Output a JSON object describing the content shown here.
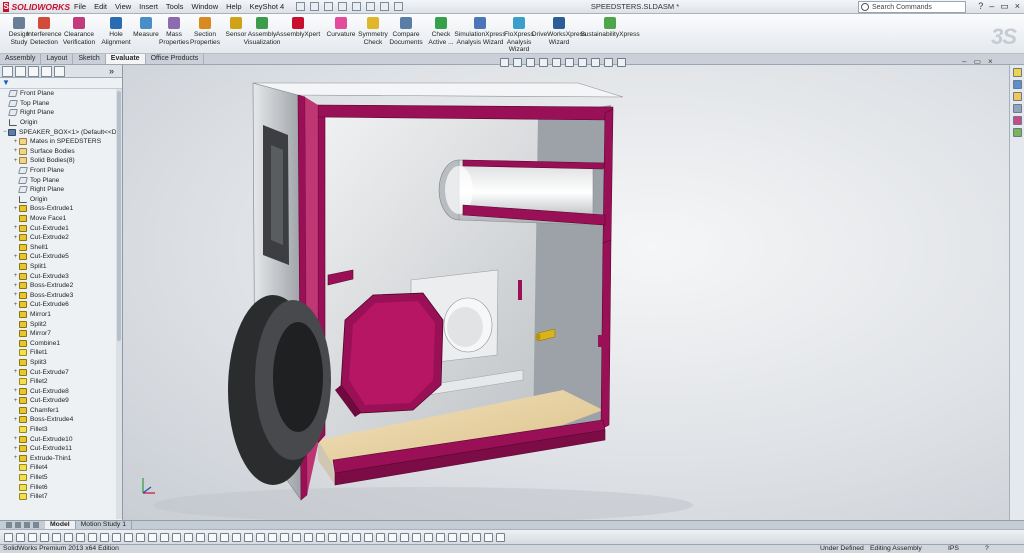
{
  "app": {
    "brand": "SOLIDWORKS",
    "document_title": "SPEEDSTERS.SLDASM *",
    "search_placeholder": "Search Commands"
  },
  "menu": [
    "File",
    "Edit",
    "View",
    "Insert",
    "Tools",
    "Window",
    "Help",
    "KeyShot 4"
  ],
  "ribbon": {
    "commands": [
      {
        "label": "Design Study",
        "icon": "design-study-icon",
        "color": "#6a7f95"
      },
      {
        "label": "Interference Detection",
        "icon": "interference-icon",
        "color": "#d14a3a"
      },
      {
        "label": "Clearance Verification",
        "icon": "clearance-icon",
        "color": "#c23b7a"
      },
      {
        "label": "Hole Alignment",
        "icon": "hole-alignment-icon",
        "color": "#2a6cb0"
      },
      {
        "label": "Measure",
        "icon": "measure-icon",
        "color": "#4a8dc8"
      },
      {
        "label": "Mass Properties",
        "icon": "mass-properties-icon",
        "color": "#8c6bb1"
      },
      {
        "label": "Section Properties",
        "icon": "section-properties-icon",
        "color": "#d98a1f"
      },
      {
        "label": "Sensor",
        "icon": "sensor-icon",
        "color": "#d0a216"
      },
      {
        "label": "Assembly Visualization",
        "icon": "assembly-visualization-icon",
        "color": "#3b9c4a"
      },
      {
        "label": "AssemblyXpert",
        "icon": "assemblyxpert-icon",
        "color": "#c8102e"
      },
      {
        "label": "Curvature",
        "icon": "curvature-icon",
        "color": "#e24c9a"
      },
      {
        "label": "Symmetry Check",
        "icon": "symmetry-check-icon",
        "color": "#e0b62a"
      },
      {
        "label": "Compare Documents",
        "icon": "compare-documents-icon",
        "color": "#5b7ea4"
      },
      {
        "label": "Check Active ...",
        "icon": "check-active-icon",
        "color": "#35a14a"
      },
      {
        "label": "SimulationXpress Analysis Wizard",
        "icon": "simulationxpress-icon",
        "color": "#4b77b8"
      },
      {
        "label": "FloXpress Analysis Wizard",
        "icon": "floxpress-icon",
        "color": "#3aa0c9"
      },
      {
        "label": "DriveWorksXpress Wizard",
        "icon": "driveworksxpress-icon",
        "color": "#2c5d97"
      },
      {
        "label": "SustainabilityXpress",
        "icon": "sustainabilityxpress-icon",
        "color": "#4ea64a"
      }
    ]
  },
  "command_tabs": [
    {
      "label": "Assembly",
      "active": false
    },
    {
      "label": "Layout",
      "active": false
    },
    {
      "label": "Sketch",
      "active": false
    },
    {
      "label": "Evaluate",
      "active": true
    },
    {
      "label": "Office Products",
      "active": false
    }
  ],
  "feature_tree": [
    {
      "label": "Front Plane",
      "icon": "plane",
      "level": 0
    },
    {
      "label": "Top Plane",
      "icon": "plane",
      "level": 0
    },
    {
      "label": "Right Plane",
      "icon": "plane",
      "level": 0
    },
    {
      "label": "Origin",
      "icon": "origin",
      "level": 0
    },
    {
      "label": "SPEAKER_BOX<1> (Default<<Def",
      "icon": "asm",
      "level": 0,
      "expander": "−"
    },
    {
      "label": "Mates in SPEEDSTERS",
      "icon": "folder",
      "level": 1,
      "expander": "+"
    },
    {
      "label": "Surface Bodies",
      "icon": "folder",
      "level": 1,
      "expander": "+"
    },
    {
      "label": "Solid Bodies(8)",
      "icon": "folder",
      "level": 1,
      "expander": "+"
    },
    {
      "label": "Front Plane",
      "icon": "plane",
      "level": 1
    },
    {
      "label": "Top Plane",
      "icon": "plane",
      "level": 1
    },
    {
      "label": "Right Plane",
      "icon": "plane",
      "level": 1
    },
    {
      "label": "Origin",
      "icon": "origin",
      "level": 1
    },
    {
      "label": "Boss-Extrude1",
      "icon": "feat",
      "level": 1,
      "expander": "+"
    },
    {
      "label": "Move Face1",
      "icon": "feat",
      "level": 1
    },
    {
      "label": "Cut-Extrude1",
      "icon": "feat",
      "level": 1,
      "expander": "+"
    },
    {
      "label": "Cut-Extrude2",
      "icon": "feat",
      "level": 1,
      "expander": "+"
    },
    {
      "label": "Shell1",
      "icon": "feat",
      "level": 1
    },
    {
      "label": "Cut-Extrude5",
      "icon": "feat",
      "level": 1,
      "expander": "+"
    },
    {
      "label": "Split1",
      "icon": "feat",
      "level": 1
    },
    {
      "label": "Cut-Extrude3",
      "icon": "feat",
      "level": 1,
      "expander": "+"
    },
    {
      "label": "Boss-Extrude2",
      "icon": "feat",
      "level": 1,
      "expander": "+"
    },
    {
      "label": "Boss-Extrude3",
      "icon": "feat",
      "level": 1,
      "expander": "+"
    },
    {
      "label": "Cut-Extrude6",
      "icon": "feat",
      "level": 1,
      "expander": "+"
    },
    {
      "label": "Mirror1",
      "icon": "feat",
      "level": 1
    },
    {
      "label": "Split2",
      "icon": "feat",
      "level": 1
    },
    {
      "label": "Mirror7",
      "icon": "feat",
      "level": 1
    },
    {
      "label": "Combine1",
      "icon": "feat",
      "level": 1
    },
    {
      "label": "Fillet1",
      "icon": "fillet",
      "level": 1
    },
    {
      "label": "Split3",
      "icon": "feat",
      "level": 1
    },
    {
      "label": "Cut-Extrude7",
      "icon": "feat",
      "level": 1,
      "expander": "+"
    },
    {
      "label": "Fillet2",
      "icon": "fillet",
      "level": 1
    },
    {
      "label": "Cut-Extrude8",
      "icon": "feat",
      "level": 1,
      "expander": "+"
    },
    {
      "label": "Cut-Extrude9",
      "icon": "feat",
      "level": 1,
      "expander": "+"
    },
    {
      "label": "Chamfer1",
      "icon": "feat",
      "level": 1
    },
    {
      "label": "Boss-Extrude4",
      "icon": "feat",
      "level": 1,
      "expander": "+"
    },
    {
      "label": "Fillet3",
      "icon": "fillet",
      "level": 1
    },
    {
      "label": "Cut-Extrude10",
      "icon": "feat",
      "level": 1,
      "expander": "+"
    },
    {
      "label": "Cut-Extrude11",
      "icon": "feat",
      "level": 1,
      "expander": "+"
    },
    {
      "label": "Extrude-Thin1",
      "icon": "feat",
      "level": 1,
      "expander": "+"
    },
    {
      "label": "Fillet4",
      "icon": "fillet",
      "level": 1
    },
    {
      "label": "Fillet5",
      "icon": "fillet",
      "level": 1
    },
    {
      "label": "Fillet6",
      "icon": "fillet",
      "level": 1
    },
    {
      "label": "Fillet7",
      "icon": "fillet",
      "level": 1
    }
  ],
  "bottom_tabs": [
    {
      "label": "Model",
      "active": true
    },
    {
      "label": "Motion Study 1",
      "active": false
    }
  ],
  "status": {
    "edition": "SolidWorks Premium 2013 x64 Edition",
    "definition": "Under Defined",
    "mode": "Editing Assembly",
    "units": "IPS"
  },
  "colors": {
    "enclosure_trim": "#9a1056",
    "panel_inner": "#cdd0d3",
    "floor_wood": "#e9d5a6",
    "accent": "#c8102e"
  }
}
